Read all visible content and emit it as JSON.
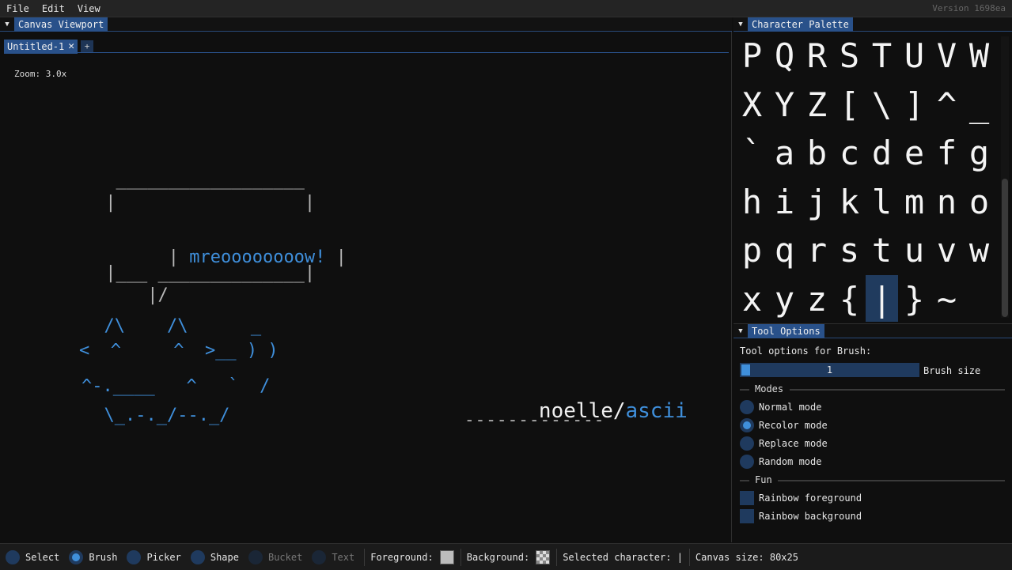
{
  "menubar": {
    "items": [
      "File",
      "Edit",
      "View"
    ],
    "version": "Version 1698ea"
  },
  "viewport": {
    "title": "Canvas Viewport",
    "tabs": [
      {
        "label": "Untitled-1",
        "close": "✕"
      }
    ],
    "add_tab": "+",
    "zoom": "Zoom: 3.0x",
    "art": {
      "bubble_top": "  __________________",
      "bubble_l1": " |                  |",
      "bubble_l2_open": " | ",
      "bubble_text": "mreoooooooow!",
      "bubble_l2_close": " |",
      "bubble_l3": " |___ ______________|",
      "bubble_tail": "     |/",
      "cat": [
        "  /\\    /\\      _",
        "<  ^     ^  >__ ) )",
        "^-.____   ^   `  /",
        "  \\_.-._/--._/"
      ],
      "logo_white": "noelle/",
      "logo_blue": "ascii",
      "logo_underline": "-------------"
    }
  },
  "palette": {
    "title": "Character Palette",
    "chars": [
      "P",
      "Q",
      "R",
      "S",
      "T",
      "U",
      "V",
      "W",
      "X",
      "Y",
      "Z",
      "[",
      "\\",
      "]",
      "^",
      "_",
      "`",
      "a",
      "b",
      "c",
      "d",
      "e",
      "f",
      "g",
      "h",
      "i",
      "j",
      "k",
      "l",
      "m",
      "n",
      "o",
      "p",
      "q",
      "r",
      "s",
      "t",
      "u",
      "v",
      "w",
      "x",
      "y",
      "z",
      "{",
      "|",
      "}",
      "~"
    ],
    "selected": "|"
  },
  "tool_options": {
    "title": "Tool Options",
    "header": "Tool options for Brush:",
    "brush_size": {
      "value": "1",
      "label": "Brush size"
    },
    "modes_label": "Modes",
    "modes": [
      "Normal mode",
      "Recolor mode",
      "Replace mode",
      "Random mode"
    ],
    "selected_mode": 1,
    "fun_label": "Fun",
    "fun": [
      "Rainbow foreground",
      "Rainbow background"
    ]
  },
  "statusbar": {
    "tools": [
      "Select",
      "Brush",
      "Picker",
      "Shape",
      "Bucket",
      "Text"
    ],
    "active_tool": "Brush",
    "foreground_label": "Foreground:",
    "background_label": "Background:",
    "selected_char_label": "Selected character: |",
    "canvas_size": "Canvas size: 80x25"
  },
  "colors": {
    "accent": "#3f8fdb",
    "title_bg": "#29518a",
    "foreground": "#bcbcbc"
  }
}
